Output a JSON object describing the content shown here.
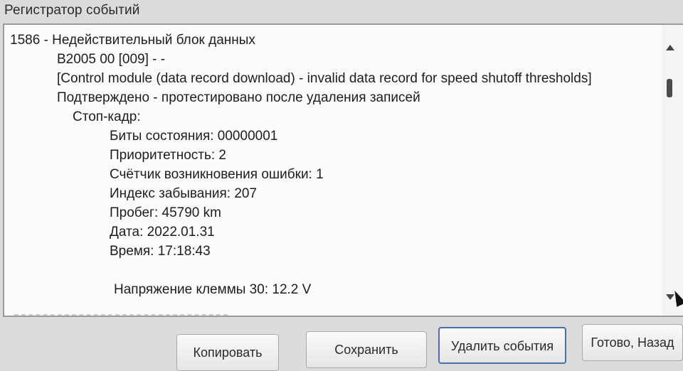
{
  "window": {
    "title": "Регистратор событий"
  },
  "log": {
    "header": "1586 - Недействительный блок данных",
    "code": "B2005 00 [009] - -",
    "description": "[Control module (data record download) - invalid data record for speed shutoff thresholds]",
    "status": "Подтверждено - протестировано после удаления записей",
    "freeze_frame_label": "Стоп-кадр:",
    "fields": [
      "Биты состояния: 00000001",
      "Приоритетность: 2",
      "Счётчик возникновения ошибки: 1",
      "Индекс забывания: 207",
      "Пробег: 45790 km",
      "Дата: 2022.01.31",
      "Время: 17:18:43"
    ],
    "voltage": "Напряжение клеммы 30: 12.2 V"
  },
  "buttons": {
    "copy": "Копировать",
    "save": "Сохранить",
    "delete": "Удалить события",
    "done": "Готово, Назад"
  },
  "colors": {
    "background": "#dcdcdb",
    "panel": "#fbfbfb",
    "focus_border": "#4a6fb0"
  }
}
